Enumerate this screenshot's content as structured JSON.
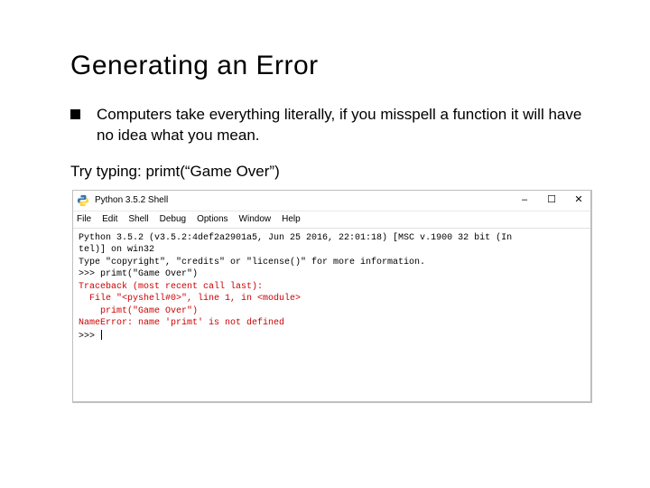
{
  "title": "Generating an Error",
  "bullet": "Computers take everything literally, if you misspell a function it will have no idea what you mean.",
  "try_line": "Try typing: primt(“Game Over”)",
  "window": {
    "title": "Python 3.5.2 Shell",
    "controls": {
      "min": "–",
      "max": "☐",
      "close": "✕"
    },
    "menu": [
      "File",
      "Edit",
      "Shell",
      "Debug",
      "Options",
      "Window",
      "Help"
    ]
  },
  "console": {
    "header1": "Python 3.5.2 (v3.5.2:4def2a2901a5, Jun 25 2016, 22:01:18) [MSC v.1900 32 bit (In",
    "header2": "tel)] on win32",
    "header3": "Type \"copyright\", \"credits\" or \"license()\" for more information.",
    "prompt1": ">>> ",
    "input1": "primt(\"Game Over\")",
    "err1": "Traceback (most recent call last):",
    "err2": "  File \"<pyshell#0>\", line 1, in <module>",
    "err3": "    primt(\"Game Over\")",
    "err4": "NameError: name 'primt' is not defined",
    "prompt2": ">>> "
  }
}
